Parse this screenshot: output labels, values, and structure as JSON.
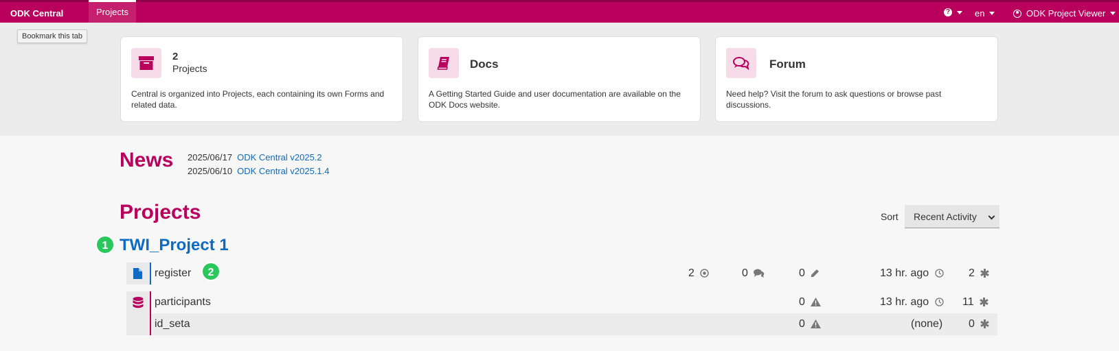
{
  "navbar": {
    "brand": "ODK Central",
    "tab_projects": "Projects",
    "language": "en",
    "user": "ODK Project Viewer"
  },
  "tooltip": "Bookmark this tab",
  "cards": {
    "projects": {
      "count": "2",
      "label": "Projects",
      "text": "Central is organized into Projects, each containing its own Forms and related data."
    },
    "docs": {
      "title": "Docs",
      "text": "A Getting Started Guide and user documentation are available on the ODK Docs website."
    },
    "forum": {
      "title": "Forum",
      "text": "Need help? Visit the forum to ask questions or browse past discussions."
    }
  },
  "news": {
    "heading": "News",
    "items": [
      {
        "date": "2025/06/17",
        "title": "ODK Central v2025.2"
      },
      {
        "date": "2025/06/10",
        "title": "ODK Central v2025.1.4"
      }
    ]
  },
  "projects_section": {
    "heading": "Projects",
    "sort_label": "Sort",
    "sort_value": "Recent Activity"
  },
  "badges": [
    "1",
    "2"
  ],
  "project": {
    "name": "TWI_Project 1",
    "form": {
      "name": "register",
      "reviewable": "2",
      "comments": "0",
      "edits": "0",
      "last_submission": "13 hr. ago",
      "total": "2"
    },
    "entity_lists": [
      {
        "name": "participants",
        "conflicts": "0",
        "last_update": "13 hr. ago",
        "total": "11"
      },
      {
        "name": "id_seta",
        "conflicts": "0",
        "last_update": "(none)",
        "total": "0"
      }
    ]
  },
  "colors": {
    "brand": "#b8005c",
    "link": "#0e6bc4",
    "badge": "#2ac75c",
    "form_bar": "#0e6bc4",
    "entity_bar": "#b8005c"
  },
  "icons": [
    "folder-icon",
    "book-icon",
    "comments-icon",
    "file-icon",
    "database-icon",
    "dot-circle-icon",
    "comment-icon",
    "pencil-icon",
    "clock-icon",
    "asterisk-icon",
    "warning-icon",
    "help-icon",
    "user-circle-icon"
  ]
}
